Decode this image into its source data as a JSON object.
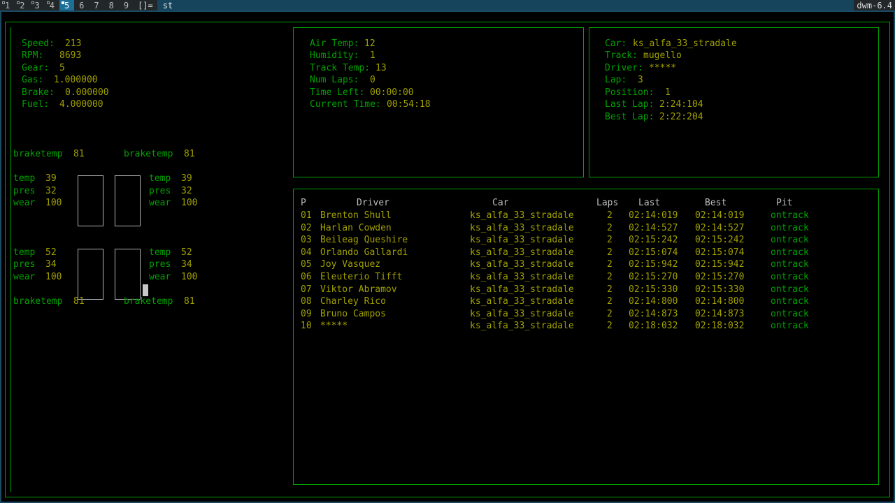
{
  "bar": {
    "tags": [
      {
        "label": "1",
        "selected": false,
        "marked": true
      },
      {
        "label": "2",
        "selected": false,
        "marked": true
      },
      {
        "label": "3",
        "selected": false,
        "marked": true
      },
      {
        "label": "4",
        "selected": false,
        "marked": true
      },
      {
        "label": "5",
        "selected": true,
        "marked": true
      },
      {
        "label": "6",
        "selected": false,
        "marked": false
      },
      {
        "label": "7",
        "selected": false,
        "marked": false
      },
      {
        "label": "8",
        "selected": false,
        "marked": false
      },
      {
        "label": "9",
        "selected": false,
        "marked": false
      }
    ],
    "layout": "[]=",
    "window_title": "st",
    "status": "dwm-6.4"
  },
  "telemetry": {
    "labels": {
      "speed": "Speed:",
      "rpm": "RPM:",
      "gear": "Gear:",
      "gas": "Gas:",
      "brake": "Brake:",
      "fuel": "Fuel:"
    },
    "values": {
      "speed": "213",
      "rpm": "8693",
      "gear": "5",
      "gas": "1.000000",
      "brake": "0.000000",
      "fuel": "4.000000"
    }
  },
  "tires": {
    "front_left": {
      "braketemp_label": "braketemp",
      "braketemp": "81",
      "temp_label": "temp",
      "temp": "39",
      "pres_label": "pres",
      "pres": "32",
      "wear_label": "wear",
      "wear": "100"
    },
    "front_right": {
      "braketemp_label": "braketemp",
      "braketemp": "81",
      "temp_label": "temp",
      "temp": "39",
      "pres_label": "pres",
      "pres": "32",
      "wear_label": "wear",
      "wear": "100"
    },
    "rear_left": {
      "braketemp_label": "braketemp",
      "braketemp": "81",
      "temp_label": "temp",
      "temp": "52",
      "pres_label": "pres",
      "pres": "34",
      "wear_label": "wear",
      "wear": "100"
    },
    "rear_right": {
      "braketemp_label": "braketemp",
      "braketemp": "81",
      "temp_label": "temp",
      "temp": "52",
      "pres_label": "pres",
      "pres": "34",
      "wear_label": "wear",
      "wear": "100"
    }
  },
  "session": {
    "labels": {
      "air_temp": "Air Temp:",
      "humidity": "Humidity:",
      "track_temp": "Track Temp:",
      "num_laps": "Num Laps:",
      "time_left": "Time Left:",
      "current_time": "Current Time:"
    },
    "values": {
      "air_temp": "12",
      "humidity": "1",
      "track_temp": "13",
      "num_laps": "0",
      "time_left": "00:00:00",
      "current_time": "00:54:18"
    }
  },
  "entry": {
    "labels": {
      "car": "Car:",
      "track": "Track:",
      "driver": "Driver:",
      "lap": "Lap:",
      "position": "Position:",
      "last_lap": "Last Lap:",
      "best_lap": "Best Lap:"
    },
    "values": {
      "car": "ks_alfa_33_stradale",
      "track": "mugello",
      "driver": "*****",
      "lap": "3",
      "position": "1",
      "last_lap": "2:24:104",
      "best_lap": "2:22:204"
    }
  },
  "leaderboard": {
    "headers": {
      "p": "P",
      "driver": "Driver",
      "car": "Car",
      "laps": "Laps",
      "last": "Last",
      "best": "Best",
      "pit": "Pit"
    },
    "rows": [
      {
        "p": "01",
        "driver": "Brenton Shull",
        "car": "ks_alfa_33_stradale",
        "laps": "2",
        "last": "02:14:019",
        "best": "02:14:019",
        "pit": "ontrack"
      },
      {
        "p": "02",
        "driver": "Harlan Cowden",
        "car": "ks_alfa_33_stradale",
        "laps": "2",
        "last": "02:14:527",
        "best": "02:14:527",
        "pit": "ontrack"
      },
      {
        "p": "03",
        "driver": "Beileag Queshire",
        "car": "ks_alfa_33_stradale",
        "laps": "2",
        "last": "02:15:242",
        "best": "02:15:242",
        "pit": "ontrack"
      },
      {
        "p": "04",
        "driver": "Orlando Gallardi",
        "car": "ks_alfa_33_stradale",
        "laps": "2",
        "last": "02:15:074",
        "best": "02:15:074",
        "pit": "ontrack"
      },
      {
        "p": "05",
        "driver": "Joy Vasquez",
        "car": "ks_alfa_33_stradale",
        "laps": "2",
        "last": "02:15:942",
        "best": "02:15:942",
        "pit": "ontrack"
      },
      {
        "p": "06",
        "driver": "Eleuterio Tifft",
        "car": "ks_alfa_33_stradale",
        "laps": "2",
        "last": "02:15:270",
        "best": "02:15:270",
        "pit": "ontrack"
      },
      {
        "p": "07",
        "driver": "Viktor Abramov",
        "car": "ks_alfa_33_stradale",
        "laps": "2",
        "last": "02:15:330",
        "best": "02:15:330",
        "pit": "ontrack"
      },
      {
        "p": "08",
        "driver": "Charley Rico",
        "car": "ks_alfa_33_stradale",
        "laps": "2",
        "last": "02:14:800",
        "best": "02:14:800",
        "pit": "ontrack"
      },
      {
        "p": "09",
        "driver": "Bruno Campos",
        "car": "ks_alfa_33_stradale",
        "laps": "2",
        "last": "02:14:873",
        "best": "02:14:873",
        "pit": "ontrack"
      },
      {
        "p": "10",
        "driver": "*****",
        "car": "ks_alfa_33_stradale",
        "laps": "2",
        "last": "02:18:032",
        "best": "02:18:032",
        "pit": "ontrack"
      }
    ]
  },
  "colors": {
    "label_green": "#00a000",
    "value_yellow": "#a0a000",
    "header_white": "#bfbfbf",
    "pit_green": "#00a000",
    "frame_green": "#00a000",
    "bar_selected": "#1b6f98",
    "window_border": "#1b4a63"
  }
}
